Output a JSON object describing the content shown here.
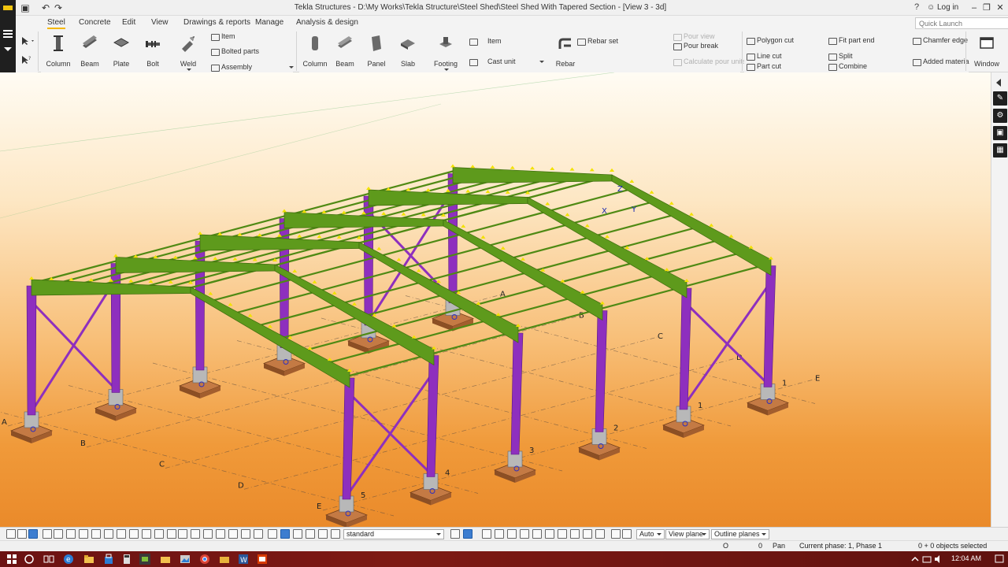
{
  "window": {
    "title": "Tekla Structures - D:\\My Works\\Tekla Structure\\Steel Shed\\Steel Shed With Tapered Section - [View 3 - 3d]",
    "login_label": "Log in",
    "quick_launch_placeholder": "Quick Launch"
  },
  "tabs": [
    {
      "label": "Steel",
      "active": true
    },
    {
      "label": "Concrete"
    },
    {
      "label": "Edit"
    },
    {
      "label": "View"
    },
    {
      "label": "Drawings & reports"
    },
    {
      "label": "Manage"
    },
    {
      "label": "Analysis & design"
    }
  ],
  "ribbon": {
    "steel": {
      "column": "Column",
      "beam": "Beam",
      "plate": "Plate",
      "bolt": "Bolt",
      "weld": "Weld",
      "item": "Item",
      "bolted_parts": "Bolted parts",
      "assembly": "Assembly"
    },
    "concrete": {
      "column": "Column",
      "beam": "Beam",
      "panel": "Panel",
      "slab": "Slab",
      "footing": "Footing",
      "item": "Item",
      "cast_unit": "Cast unit",
      "rebar": "Rebar",
      "rebar_set": "Rebar set",
      "pour_view": "Pour view",
      "pour_break": "Pour break",
      "calculate_pour_units": "Calculate pour units"
    },
    "edit": {
      "polygon_cut": "Polygon cut",
      "line_cut": "Line cut",
      "part_cut": "Part cut",
      "fit_part_end": "Fit part end",
      "split": "Split",
      "combine": "Combine",
      "chamfer_edge": "Chamfer edge",
      "added_material": "Added materia"
    },
    "window": "Window"
  },
  "model": {
    "grid_letters": [
      "A",
      "B",
      "C",
      "D",
      "E"
    ],
    "grid_numbers": [
      "1",
      "2",
      "3",
      "4",
      "5"
    ],
    "wcs_labels": [
      "Z",
      "X",
      "Y"
    ],
    "colors": {
      "column": "#8e2fbe",
      "rafter": "#5e9a1c",
      "purlin": "#4f8a14",
      "footing": "#b56a3a",
      "pedestal": "#b8b8b8",
      "bolt": "#f2e200",
      "background_top": "#fffcf4",
      "background_bottom": "#ea8a2a"
    }
  },
  "bottom_toolbar": {
    "standard": "standard",
    "auto": "Auto",
    "view_plane": "View plane",
    "outline_planes": "Outline planes"
  },
  "status": {
    "o_value": "O",
    "zero": "0",
    "pan": "Pan",
    "phase": "Current phase: 1, Phase 1",
    "selection": "0 + 0 objects selected"
  },
  "taskbar": {
    "time": "12:04 AM"
  }
}
